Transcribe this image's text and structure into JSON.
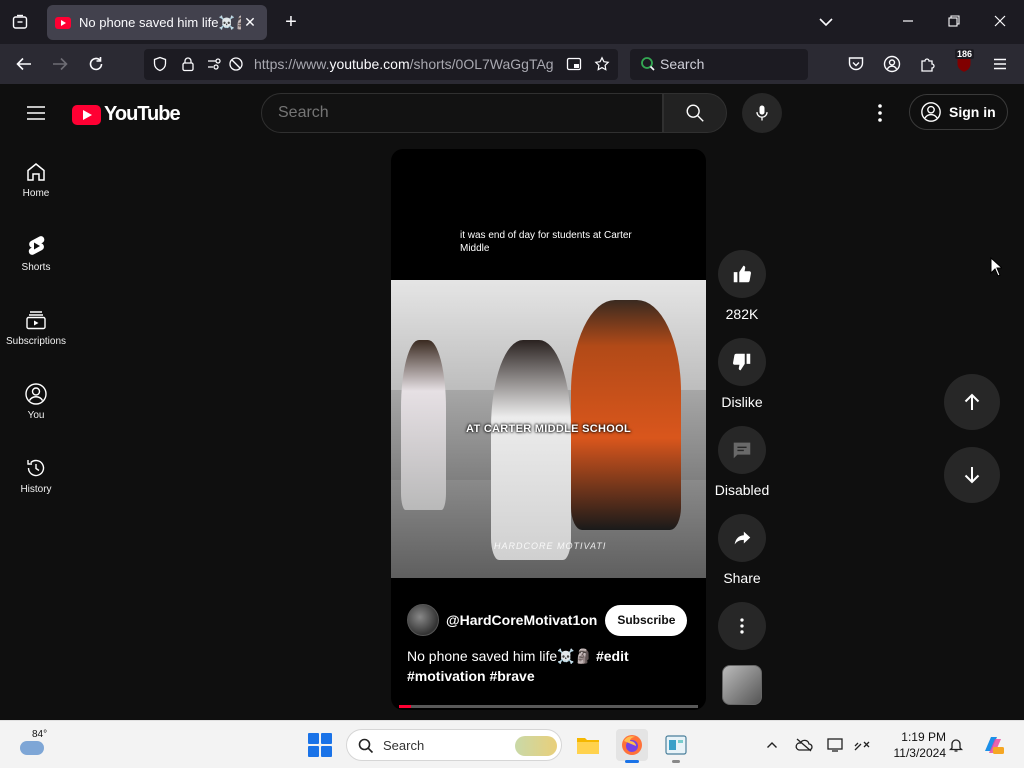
{
  "browser": {
    "tab_title": "No phone saved him life☠️🗿",
    "tab_close": "✕",
    "new_tab": "+",
    "url_prefix": "https://www.",
    "url_domain": "youtube.com",
    "url_path": "/shorts/0OL7WaGgTAg",
    "search_label": "Search",
    "extensions_badge": "186"
  },
  "youtube": {
    "logo_text": "YouTube",
    "search_placeholder": "Search",
    "sign_in": "Sign in",
    "sidebar": [
      {
        "label": "Home",
        "icon": "home-icon"
      },
      {
        "label": "Shorts",
        "icon": "shorts-icon"
      },
      {
        "label": "Subscriptions",
        "icon": "subscriptions-icon"
      },
      {
        "label": "You",
        "icon": "you-icon"
      },
      {
        "label": "History",
        "icon": "history-icon"
      }
    ],
    "short": {
      "caption_top": "it was end of day for students at Carter Middle",
      "overlay_text": "AT CARTER MIDDLE SCHOOL",
      "watermark": "HARDCORE MOTIVATI",
      "channel": "@HardCoreMotivat1on",
      "subscribe": "Subscribe",
      "title_text": "No phone saved him life☠️🗿 ",
      "hashtag_1": "#edit",
      "hashtag_2": "#motivation",
      "hashtag_3": "#brave",
      "progress_fraction": 0.04
    },
    "actions": {
      "likes": "282K",
      "dislike": "Dislike",
      "comments": "Disabled",
      "share": "Share"
    }
  },
  "taskbar": {
    "temperature": "84°",
    "search_label": "Search",
    "time": "1:19 PM",
    "date": "11/3/2024"
  },
  "colors": {
    "yt_red": "#ff0033",
    "bg": "#0f0f0f",
    "button_bg": "#272727"
  }
}
